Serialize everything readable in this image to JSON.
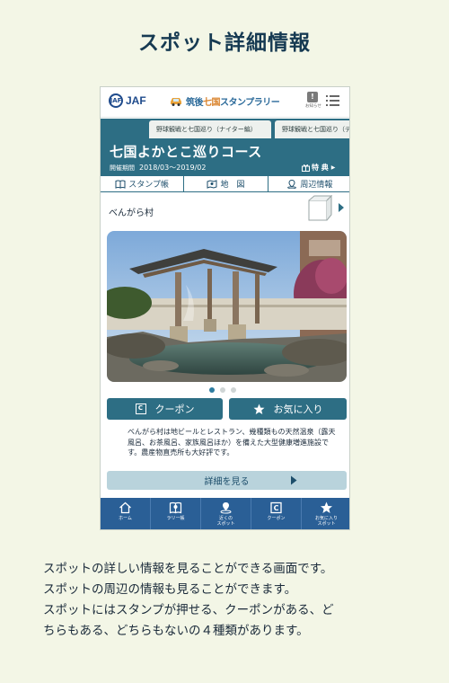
{
  "page": {
    "heading": "スポット詳細情報",
    "caption": [
      "スポットの詳しい情報を見ることができる画面です。",
      "スポットの周辺の情報も見ることができます。",
      "スポットにはスタンプが押せる、クーポンがある、ど",
      "ちらもある、どちらもないの４種類があります。"
    ]
  },
  "app": {
    "header": {
      "jaf_emblem": "JAF",
      "jaf_text": "JAF",
      "rally_title_pre": "筑後",
      "rally_title_hl": "七国",
      "rally_title_post": "スタンプラリー",
      "notice_label": "お知らせ"
    },
    "course_tabs": [
      "野球観戦と七国巡り（ナイター編）",
      "野球観戦と七国巡り（デーゲーム編）"
    ],
    "course": {
      "title": "七国よかとこ巡りコース",
      "period_label": "開催期間",
      "period": "2018/03〜2019/02",
      "tokuten": "特 典",
      "tokuten_arrow": "▶"
    },
    "nav": {
      "stamp_book": "スタンプ帳",
      "map": "地　図",
      "nearby": "周辺情報"
    },
    "spot": {
      "name": "べんがら村",
      "description": "べんがら村は地ビールとレストラン、幾種類もの天然温泉（露天風呂、お茶風呂、家族風呂ほか）を備えた大型健康増進施設です。農産物直売所も大好評です。",
      "photo_index": 1,
      "photo_count": 3
    },
    "actions": {
      "coupon": "クーポン",
      "coupon_icon": "C",
      "favorite": "お気に入り",
      "detail": "詳細を見る"
    },
    "tab_bar": [
      {
        "label": "ホーム",
        "icon": "home-icon"
      },
      {
        "label": "ラリー帳",
        "icon": "rally-book-icon"
      },
      {
        "label": "近くの\nスポット",
        "icon": "nearby-spot-icon"
      },
      {
        "label": "クーポン",
        "icon": "coupon-icon"
      },
      {
        "label": "お気に入り\nスポット",
        "icon": "star-icon"
      }
    ],
    "colors": {
      "primary": "#2d6e84",
      "tab_bar": "#2a5f96",
      "detail_button": "#b9d3dc",
      "background": "#f3f6e6"
    }
  }
}
